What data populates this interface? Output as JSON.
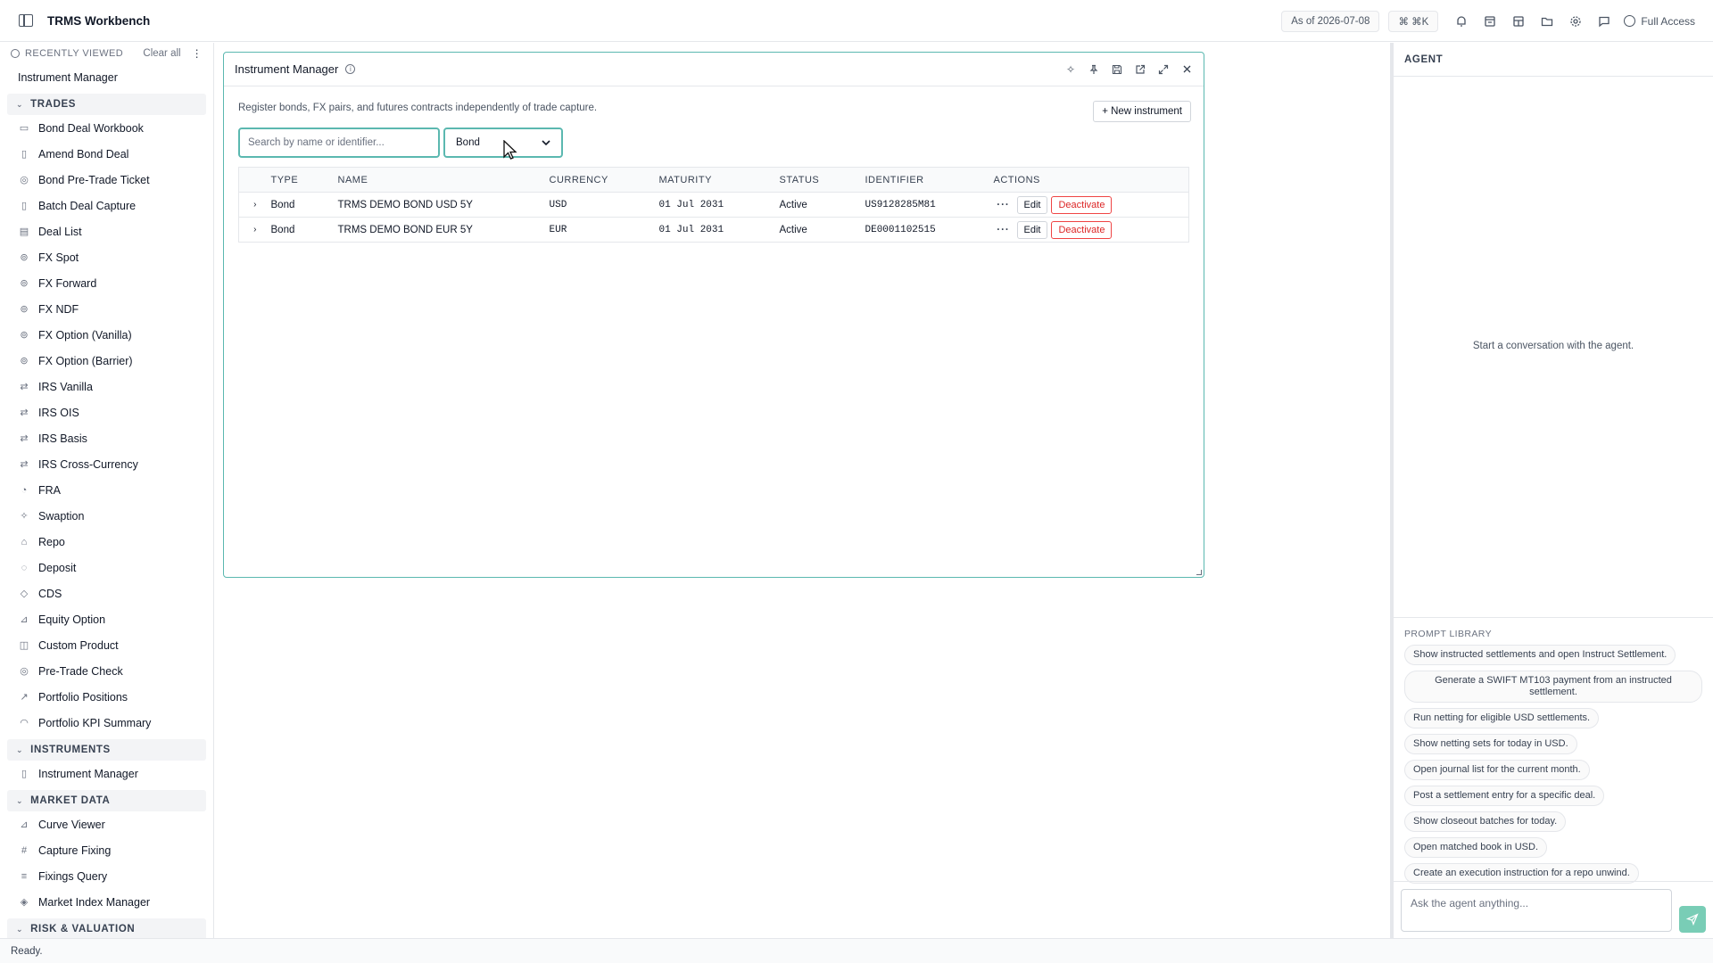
{
  "app": {
    "title": "TRMS Workbench"
  },
  "topbar": {
    "as_of": "As of 2026-07-08",
    "shortcut": "⌘ ⌘K",
    "full_access": "Full Access"
  },
  "sidebar": {
    "recent_heading": "RECENTLY VIEWED",
    "clear_all": "Clear all",
    "recent_items": [
      "Instrument Manager"
    ],
    "sections": [
      {
        "label": "TRADES",
        "items": [
          {
            "label": "Bond Deal Workbook",
            "icon": "book-icon"
          },
          {
            "label": "Amend Bond Deal",
            "icon": "file-icon"
          },
          {
            "label": "Bond Pre-Trade Ticket",
            "icon": "check-circle-icon"
          },
          {
            "label": "Batch Deal Capture",
            "icon": "file-icon"
          },
          {
            "label": "Deal List",
            "icon": "document-icon"
          },
          {
            "label": "FX Spot",
            "icon": "coins-icon"
          },
          {
            "label": "FX Forward",
            "icon": "coins-icon"
          },
          {
            "label": "FX NDF",
            "icon": "coins-icon"
          },
          {
            "label": "FX Option (Vanilla)",
            "icon": "coins-icon"
          },
          {
            "label": "FX Option (Barrier)",
            "icon": "coins-icon"
          },
          {
            "label": "IRS Vanilla",
            "icon": "swap-icon"
          },
          {
            "label": "IRS OIS",
            "icon": "swap-icon"
          },
          {
            "label": "IRS Basis",
            "icon": "swap-icon"
          },
          {
            "label": "IRS Cross-Currency",
            "icon": "swap-icon"
          },
          {
            "label": "FRA",
            "icon": "timer-icon"
          },
          {
            "label": "Swaption",
            "icon": "sparkle-icon"
          },
          {
            "label": "Repo",
            "icon": "bank-icon"
          },
          {
            "label": "Deposit",
            "icon": "piggy-icon"
          },
          {
            "label": "CDS",
            "icon": "shield-icon"
          },
          {
            "label": "Equity Option",
            "icon": "chart-icon"
          },
          {
            "label": "Custom Product",
            "icon": "box-icon"
          },
          {
            "label": "Pre-Trade Check",
            "icon": "check-circle-icon"
          },
          {
            "label": "Portfolio Positions",
            "icon": "trend-icon"
          },
          {
            "label": "Portfolio KPI Summary",
            "icon": "gauge-icon"
          }
        ]
      },
      {
        "label": "INSTRUMENTS",
        "items": [
          {
            "label": "Instrument Manager",
            "icon": "file-icon"
          }
        ]
      },
      {
        "label": "MARKET DATA",
        "items": [
          {
            "label": "Curve Viewer",
            "icon": "chart-icon"
          },
          {
            "label": "Capture Fixing",
            "icon": "hash-icon"
          },
          {
            "label": "Fixings Query",
            "icon": "database-icon"
          },
          {
            "label": "Market Index Manager",
            "icon": "tag-icon"
          }
        ]
      },
      {
        "label": "RISK & VALUATION",
        "items": []
      }
    ]
  },
  "panel": {
    "title": "Instrument Manager",
    "description": "Register bonds, FX pairs, and futures contracts independently of trade capture.",
    "new_button": "+ New instrument",
    "search_placeholder": "Search by name or identifier...",
    "type_filter": "Bond",
    "columns": [
      "TYPE",
      "NAME",
      "CURRENCY",
      "MATURITY",
      "STATUS",
      "IDENTIFIER",
      "ACTIONS"
    ],
    "rows": [
      {
        "type": "Bond",
        "name": "TRMS DEMO BOND USD 5Y",
        "currency": "USD",
        "maturity": "01 Jul 2031",
        "status": "Active",
        "identifier": "US9128285M81",
        "more": "···",
        "edit": "Edit",
        "deactivate": "Deactivate"
      },
      {
        "type": "Bond",
        "name": "TRMS DEMO BOND EUR 5Y",
        "currency": "EUR",
        "maturity": "01 Jul 2031",
        "status": "Active",
        "identifier": "DE0001102515",
        "more": "···",
        "edit": "Edit",
        "deactivate": "Deactivate"
      }
    ]
  },
  "agent": {
    "title": "AGENT",
    "empty": "Start a conversation with the agent.",
    "prompt_library_heading": "PROMPT LIBRARY",
    "prompts": [
      "Show instructed settlements and open Instruct Settlement.",
      "Generate a SWIFT MT103 payment from an instructed settlement.",
      "Run netting for eligible USD settlements.",
      "Show netting sets for today in USD.",
      "Open journal list for the current month.",
      "Post a settlement entry for a specific deal.",
      "Show closeout batches for today.",
      "Open matched book in USD.",
      "Create an execution instruction for a repo unwind."
    ],
    "input_placeholder": "Ask the agent anything..."
  },
  "status": {
    "text": "Ready."
  },
  "colors": {
    "accent": "#5bb8b0",
    "danger": "#dc2626",
    "send": "#79cdb6"
  }
}
